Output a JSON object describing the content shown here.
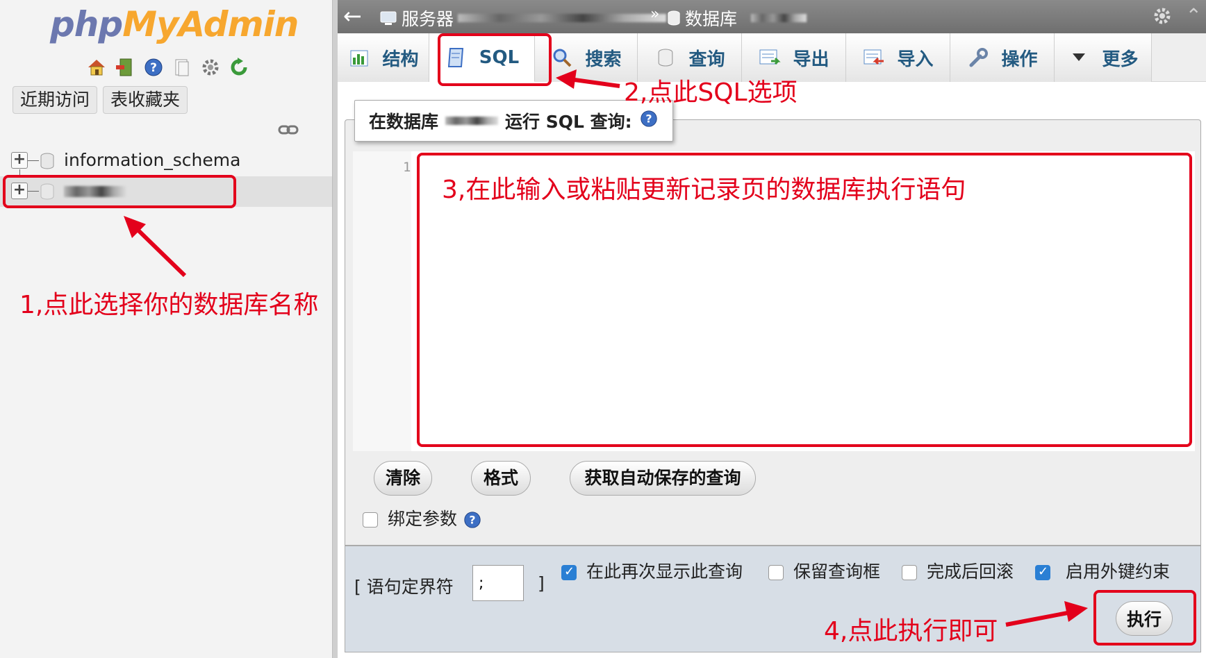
{
  "nav": {
    "logo_php": "php",
    "logo_myadmin": "MyAdmin",
    "icons": [
      "home-icon",
      "exit-icon",
      "help-icon",
      "docs-icon",
      "settings-icon",
      "reload-icon"
    ],
    "recent_label": "近期访问",
    "favorites_label": "表收藏夹",
    "tree": [
      {
        "label": "information_schema"
      },
      {
        "label": ""
      }
    ]
  },
  "topbar": {
    "server_label": "服务器",
    "separator": "»",
    "db_label": "数据库"
  },
  "tabs": [
    {
      "label": "结构",
      "icon": "structure-icon"
    },
    {
      "label": "SQL",
      "icon": "sql-icon"
    },
    {
      "label": "搜索",
      "icon": "search-icon"
    },
    {
      "label": "查询",
      "icon": "query-icon"
    },
    {
      "label": "导出",
      "icon": "export-icon"
    },
    {
      "label": "导入",
      "icon": "import-icon"
    },
    {
      "label": "操作",
      "icon": "wrench-icon"
    },
    {
      "label": "更多",
      "icon": "chevron-down-icon"
    }
  ],
  "query": {
    "legend_prefix": "在数据库",
    "legend_suffix": "运行 SQL 查询:",
    "line_number": "1",
    "sql_value": "",
    "clear_label": "清除",
    "format_label": "格式",
    "autosave_label": "获取自动保存的查询",
    "bind_params_label": "绑定参数"
  },
  "options": {
    "delimiter_label": "[ 语句定界符",
    "delimiter_value": ";",
    "delimiter_close": "]",
    "show_query_label": "在此再次显示此查询",
    "show_query_checked": true,
    "retain_box_label": "保留查询框",
    "retain_box_checked": false,
    "rollback_label": "完成后回滚",
    "rollback_checked": false,
    "fk_checks_label": "启用外键约束",
    "fk_checks_checked": true,
    "go_label": "执行"
  },
  "annotations": {
    "step1": "1,点此选择你的数据库名称",
    "step2": "2,点此SQL选项",
    "step3": "3,在此输入或粘贴更新记录页的数据库执行语句",
    "step4": "4,点此执行即可"
  },
  "colors": {
    "annotation_red": "#e3001b",
    "tab_text": "#235a81",
    "checkbox_blue": "#2a7fd4"
  }
}
